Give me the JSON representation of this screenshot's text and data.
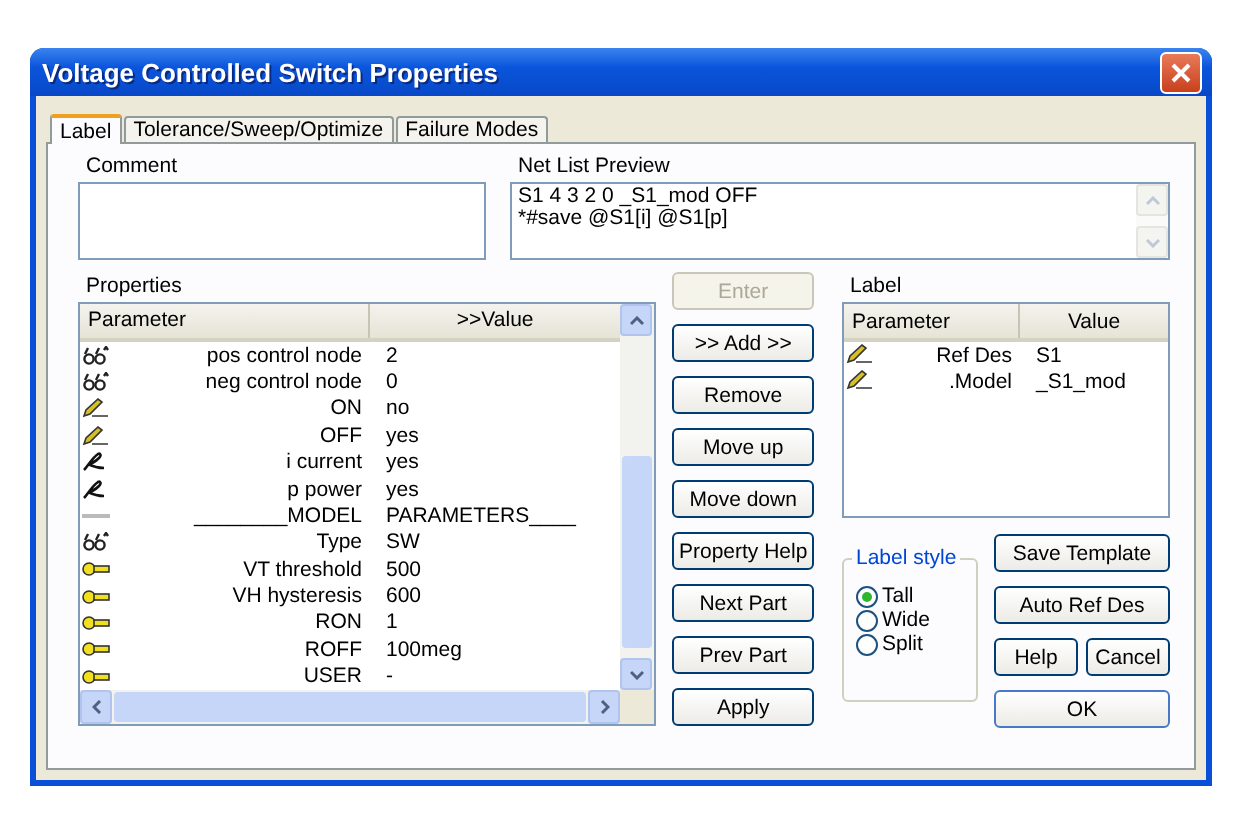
{
  "window": {
    "title": "Voltage Controlled Switch Properties"
  },
  "tabs": [
    {
      "label": "Label",
      "selected": true
    },
    {
      "label": "Tolerance/Sweep/Optimize",
      "selected": false
    },
    {
      "label": "Failure Modes",
      "selected": false
    }
  ],
  "comment": {
    "label": "Comment"
  },
  "net_list_preview": {
    "label": "Net List Preview",
    "lines": [
      "S1 4 3 2 0 _S1_mod  OFF",
      "*#save  @S1[i] @S1[p]"
    ]
  },
  "properties": {
    "label": "Properties",
    "columns": [
      "Parameter",
      ">>Value"
    ],
    "rows": [
      {
        "kind": "glasses",
        "parameter": "pos control node",
        "value": "2"
      },
      {
        "kind": "glasses",
        "parameter": "neg control node",
        "value": "0"
      },
      {
        "kind": "pencil",
        "parameter": "ON",
        "value": "no"
      },
      {
        "kind": "pencil",
        "parameter": "OFF",
        "value": "yes"
      },
      {
        "kind": "pen",
        "parameter": "i current",
        "value": "yes"
      },
      {
        "kind": "pen",
        "parameter": "p power",
        "value": "yes"
      },
      {
        "kind": "dash",
        "parameter": "________MODEL",
        "value": "PARAMETERS____"
      },
      {
        "kind": "glasses",
        "parameter": "Type",
        "value": "SW"
      },
      {
        "kind": "key",
        "parameter": "VT threshold",
        "value": "500"
      },
      {
        "kind": "key",
        "parameter": "VH hysteresis",
        "value": "600"
      },
      {
        "kind": "key",
        "parameter": "RON",
        "value": "1"
      },
      {
        "kind": "key",
        "parameter": "ROFF",
        "value": "100meg"
      },
      {
        "kind": "key",
        "parameter": "USER",
        "value": "-"
      }
    ]
  },
  "middle_buttons": [
    {
      "label": "Enter",
      "disabled": true
    },
    {
      "label": ">> Add >>",
      "disabled": false
    },
    {
      "label": "Remove",
      "disabled": false
    },
    {
      "label": "Move up",
      "disabled": false
    },
    {
      "label": "Move down",
      "disabled": false
    },
    {
      "label": "Property Help",
      "disabled": false
    },
    {
      "label": "Next Part",
      "disabled": false
    },
    {
      "label": "Prev Part",
      "disabled": false
    },
    {
      "label": "Apply",
      "disabled": false
    }
  ],
  "label_panel": {
    "label": "Label",
    "columns": [
      "Parameter",
      "Value"
    ],
    "rows": [
      {
        "kind": "pencil",
        "parameter": "Ref Des",
        "value": "S1"
      },
      {
        "kind": "pencil",
        "parameter": ".Model",
        "value": "_S1_mod"
      }
    ]
  },
  "label_style": {
    "title": "Label style",
    "options": [
      {
        "label": "Tall",
        "selected": true
      },
      {
        "label": "Wide",
        "selected": false
      },
      {
        "label": "Split",
        "selected": false
      }
    ]
  },
  "right_buttons": {
    "save_template": "Save Template",
    "auto_ref_des": "Auto Ref Des",
    "help": "Help",
    "cancel": "Cancel",
    "ok": "OK"
  }
}
